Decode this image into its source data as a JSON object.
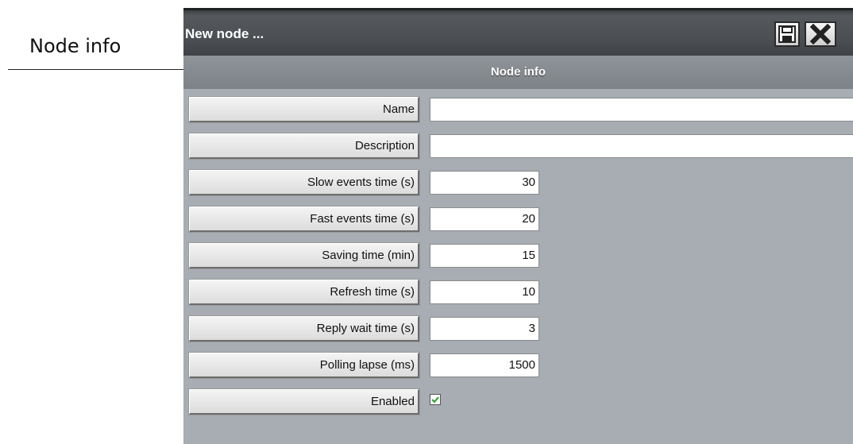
{
  "annotation": {
    "label": "Node info"
  },
  "window": {
    "title": "New node ...",
    "save_icon": "save-icon",
    "close_icon": "close-icon"
  },
  "section": {
    "title": "Node info"
  },
  "fields": [
    {
      "label": "Name",
      "value": ""
    },
    {
      "label": "Description",
      "value": ""
    },
    {
      "label": "Slow events time (s)",
      "value": "30"
    },
    {
      "label": "Fast events time (s)",
      "value": "20"
    },
    {
      "label": "Saving time (min)",
      "value": "15"
    },
    {
      "label": "Refresh time (s)",
      "value": "10"
    },
    {
      "label": "Reply wait time (s)",
      "value": "3"
    },
    {
      "label": "Polling lapse (ms)",
      "value": "1500"
    },
    {
      "label": "Enabled",
      "checked": true
    }
  ],
  "colors": {
    "titlebar": "#4c5054",
    "panel": "#a7adb3",
    "check": "#2aa02a"
  }
}
